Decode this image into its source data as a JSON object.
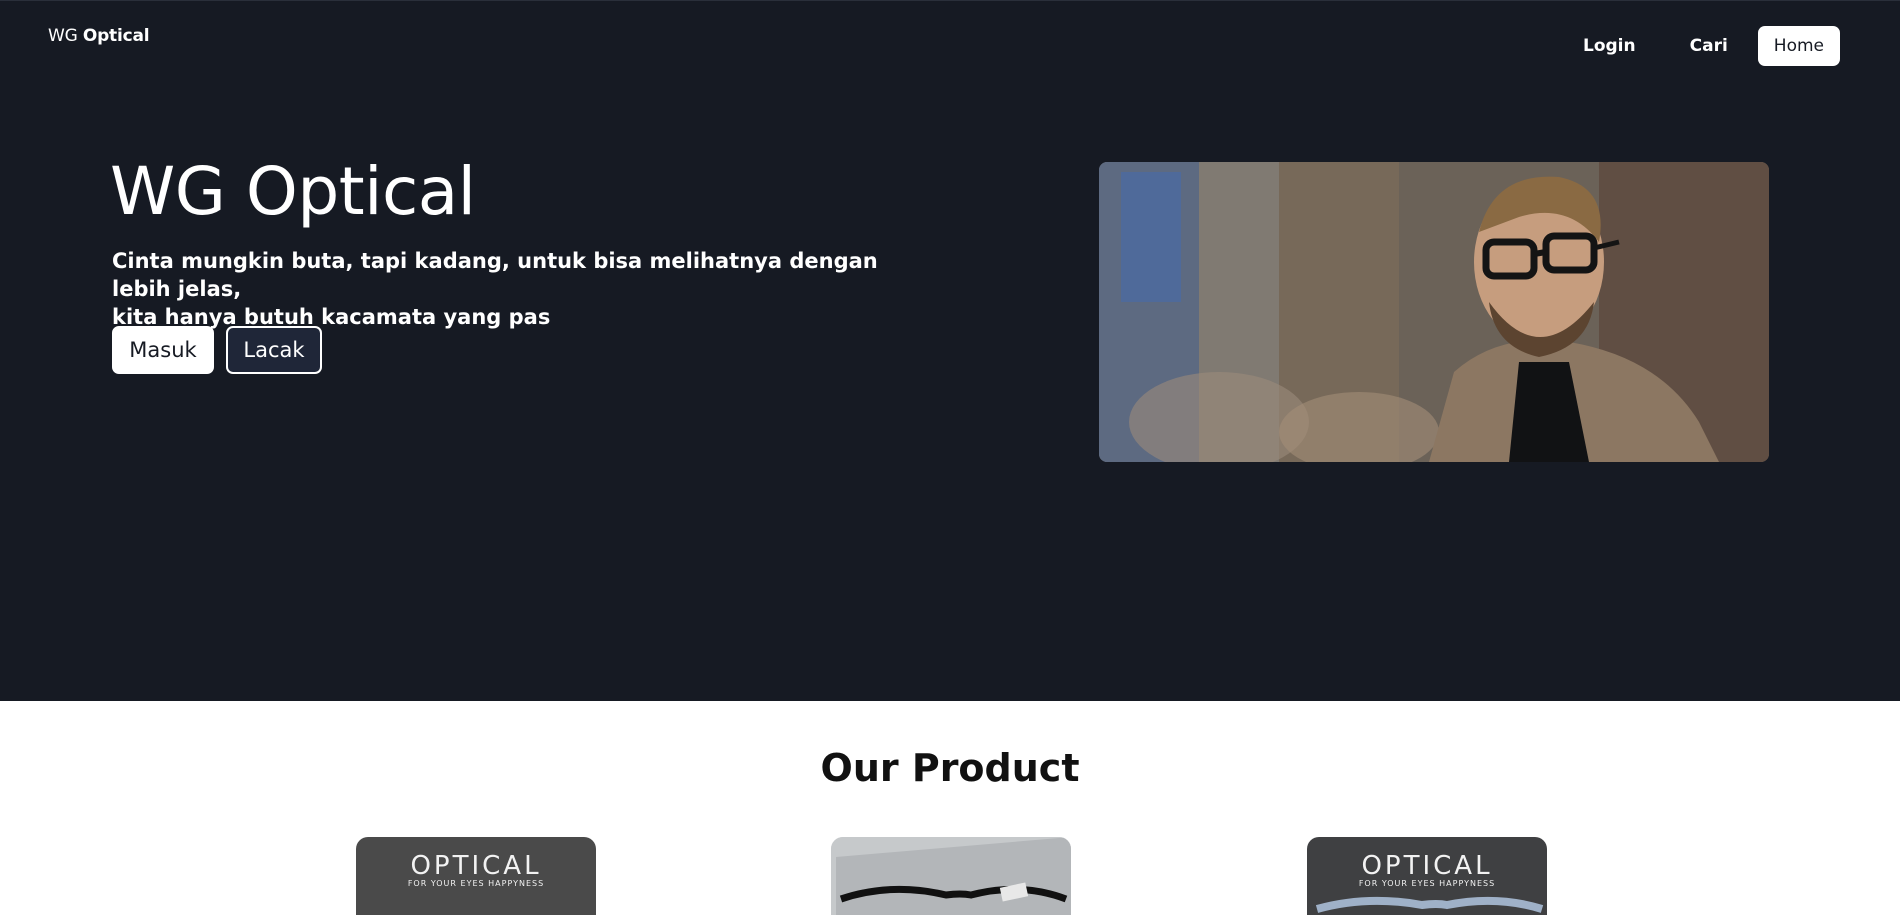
{
  "nav": {
    "brand_prefix": "WG",
    "brand_suffix": "Optical",
    "links": [
      "Login",
      "Cari",
      "Home"
    ]
  },
  "hero": {
    "title": "WG Optical",
    "subtitle_line1": "Cinta mungkin buta, tapi kadang, untuk bisa melihatnya dengan lebih jelas,",
    "subtitle_line2": "kita hanya butuh kacamata yang pas",
    "primary_button": "Masuk",
    "secondary_button": "Lacak",
    "image_alt": "man-with-glasses-photo"
  },
  "products": {
    "title": "Our Product",
    "cards": [
      {
        "logo": "OPTICAL",
        "tagline": "FOR YOUR EYES HAPPYNESS"
      },
      {
        "logo": "",
        "tagline": ""
      },
      {
        "logo": "OPTICAL",
        "tagline": "FOR YOUR EYES HAPPYNESS"
      }
    ]
  },
  "colors": {
    "hero_bg": "#161a23",
    "text_light": "#ffffff",
    "accent_dark_button": "#1f2638"
  }
}
